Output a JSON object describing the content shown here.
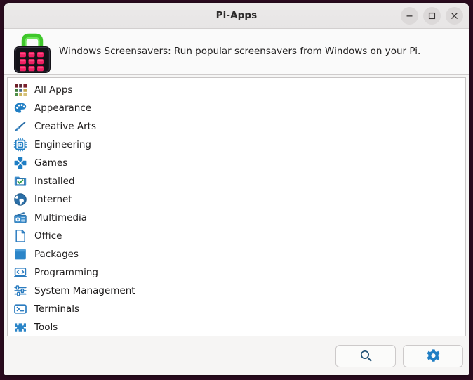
{
  "window": {
    "title": "Pi-Apps",
    "controls": [
      {
        "name": "minimize",
        "label": "Minimize"
      },
      {
        "name": "maximize",
        "label": "Maximize"
      },
      {
        "name": "close",
        "label": "Close"
      }
    ]
  },
  "header": {
    "logo_icon": "pi-apps-bag-icon",
    "description": "Windows Screensavers: Run popular screensavers from Windows on your Pi."
  },
  "categories": [
    {
      "label": "All Apps",
      "icon": "grid-apps-icon"
    },
    {
      "label": "Appearance",
      "icon": "paint-palette-icon"
    },
    {
      "label": "Creative Arts",
      "icon": "paintbrush-icon"
    },
    {
      "label": "Engineering",
      "icon": "cpu-chip-icon"
    },
    {
      "label": "Games",
      "icon": "dpad-icon"
    },
    {
      "label": "Installed",
      "icon": "folder-check-icon"
    },
    {
      "label": "Internet",
      "icon": "globe-icon"
    },
    {
      "label": "Multimedia",
      "icon": "radio-icon"
    },
    {
      "label": "Office",
      "icon": "document-icon"
    },
    {
      "label": "Packages",
      "icon": "package-box-icon"
    },
    {
      "label": "Programming",
      "icon": "code-laptop-icon"
    },
    {
      "label": "System Management",
      "icon": "sliders-icon"
    },
    {
      "label": "Terminals",
      "icon": "terminal-icon"
    },
    {
      "label": "Tools",
      "icon": "puzzle-piece-icon"
    }
  ],
  "footer": {
    "buttons": [
      {
        "name": "search",
        "icon": "search-icon",
        "label": "Search"
      },
      {
        "name": "settings",
        "icon": "gear-icon",
        "label": "Settings"
      }
    ]
  },
  "colors": {
    "accent_blue": "#1f7ec4",
    "logo_green": "#4cd137",
    "logo_pink": "#e8185c",
    "titlebar": "#e9e7e7",
    "desktop": "#2b0b1f",
    "search_icon": "#1e4f73"
  }
}
